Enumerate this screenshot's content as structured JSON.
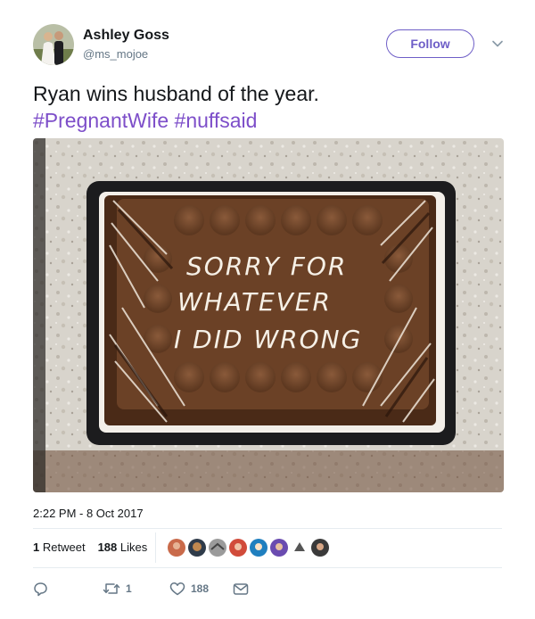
{
  "author": {
    "name": "Ashley Goss",
    "handle": "@ms_mojoe"
  },
  "follow_label": "Follow",
  "tweet": {
    "text_plain": "Ryan wins husband of the year.",
    "hashtags": [
      "#PregnantWife",
      "#nuffsaid"
    ]
  },
  "photo": {
    "cake_text": [
      "SORRY FOR",
      "WHATEVER",
      "I DID WRONG"
    ]
  },
  "timestamp": "2:22 PM - 8 Oct 2017",
  "stats": {
    "retweets_count": "1",
    "retweets_label": "Retweet",
    "likes_count": "188",
    "likes_label": "Likes"
  },
  "actions": {
    "retweet_count": "1",
    "like_count": "188"
  },
  "icons": [
    "reply-icon",
    "retweet-icon",
    "heart-icon",
    "message-icon",
    "chevron-down-icon"
  ],
  "colors": {
    "accent": "#6e5ec7",
    "hashtag": "#7d4ec9",
    "muted": "#657786",
    "text": "#14171a"
  }
}
